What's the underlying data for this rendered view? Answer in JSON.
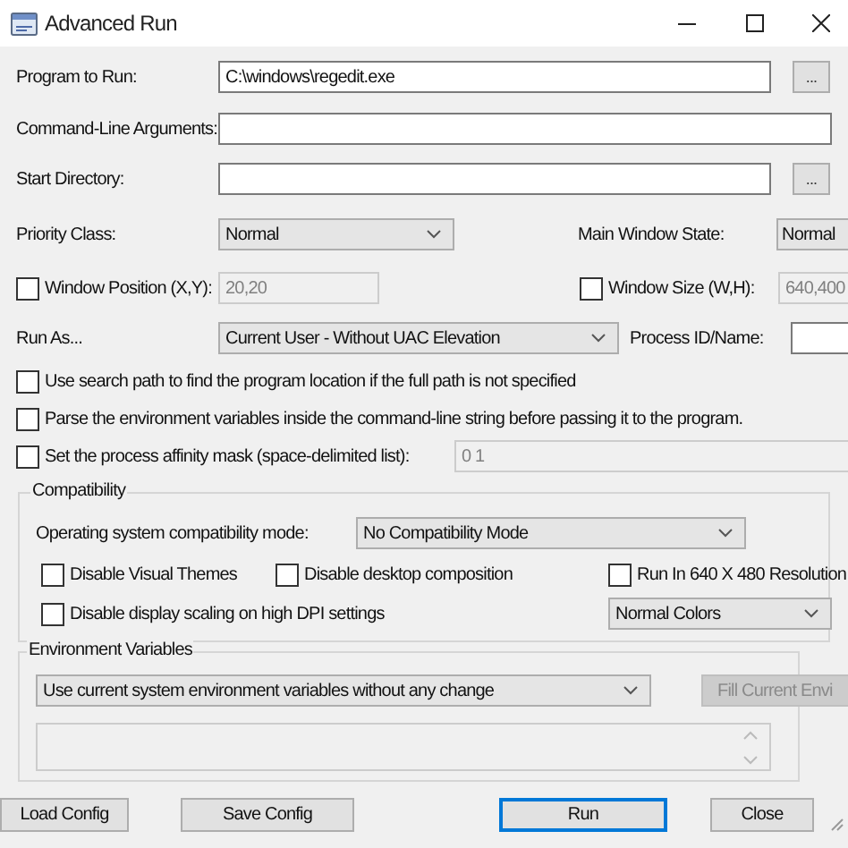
{
  "window": {
    "title": "Advanced Run"
  },
  "program": {
    "label": "Program to Run:",
    "value": "C:\\windows\\regedit.exe",
    "browse_button": "..."
  },
  "arguments": {
    "label": "Command-Line Arguments:"
  },
  "start_directory": {
    "label": "Start Directory:",
    "browse_button": "..."
  },
  "priority_class": {
    "label": "Priority Class:",
    "value": "Normal"
  },
  "main_window_state": {
    "label": "Main Window State:",
    "value": "Normal"
  },
  "window_position": {
    "label": "Window Position (X,Y):",
    "checked": false,
    "value": "20,20",
    "disabled": true
  },
  "window_size": {
    "label": "Window Size (W,H):",
    "checked": false,
    "value": "640,400",
    "disabled": true
  },
  "run_as": {
    "label": "Run As...",
    "value": "Current User - Without UAC Elevation"
  },
  "process_id": {
    "label": "Process ID/Name:"
  },
  "options": [
    {
      "label": "Use search path to find the program location if the full path is not specified",
      "checked": false
    },
    {
      "label": "Parse the environment variables inside the command-line string before passing it to the program.",
      "checked": false
    },
    {
      "label": "Set the process affinity mask (space-delimited list):",
      "checked": false,
      "value": "0 1",
      "disabled": true
    }
  ],
  "compatibility": {
    "title": "Compatibility",
    "mode_label": "Operating system compatibility mode:",
    "mode_value": "No Compatibility Mode",
    "options": [
      {
        "label": "Disable Visual Themes",
        "checked": false
      },
      {
        "label": "Disable desktop composition",
        "checked": false
      },
      {
        "label": "Run In 640 X 480 Resolution",
        "checked": false
      },
      {
        "label": "Disable display scaling on high DPI settings",
        "checked": false
      }
    ],
    "colors": "Normal Colors"
  },
  "environment": {
    "title": "Environment Variables",
    "value": "Use current system environment variables without any change",
    "fill_button": "Fill Current Envi",
    "fill_disabled": true
  },
  "buttons": [
    {
      "label": "Load Config",
      "default": false
    },
    {
      "label": "Save Config",
      "default": false
    },
    {
      "label": "Run",
      "default": true
    },
    {
      "label": "Close",
      "default": false
    }
  ]
}
